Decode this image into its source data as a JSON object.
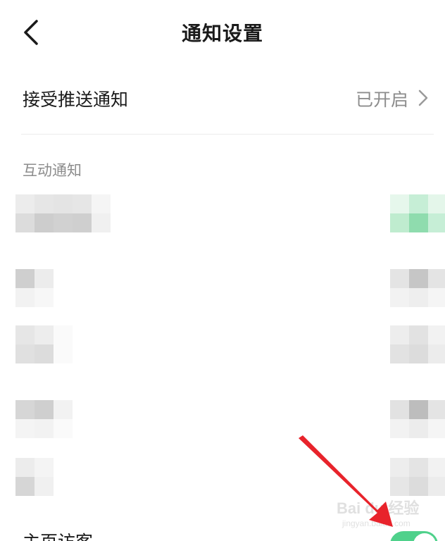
{
  "header": {
    "title": "通知设置"
  },
  "push_setting": {
    "label": "接受推送通知",
    "value": "已开启"
  },
  "section": {
    "title": "互动通知"
  },
  "bottom_row": {
    "label": "主页访客",
    "toggle_on": true
  },
  "watermark": {
    "brand": "Bai du 经验",
    "site": "jingyan.baidu.com"
  },
  "colors": {
    "toggle_on": "#4fd18b",
    "annotation_arrow": "#e8232b"
  }
}
